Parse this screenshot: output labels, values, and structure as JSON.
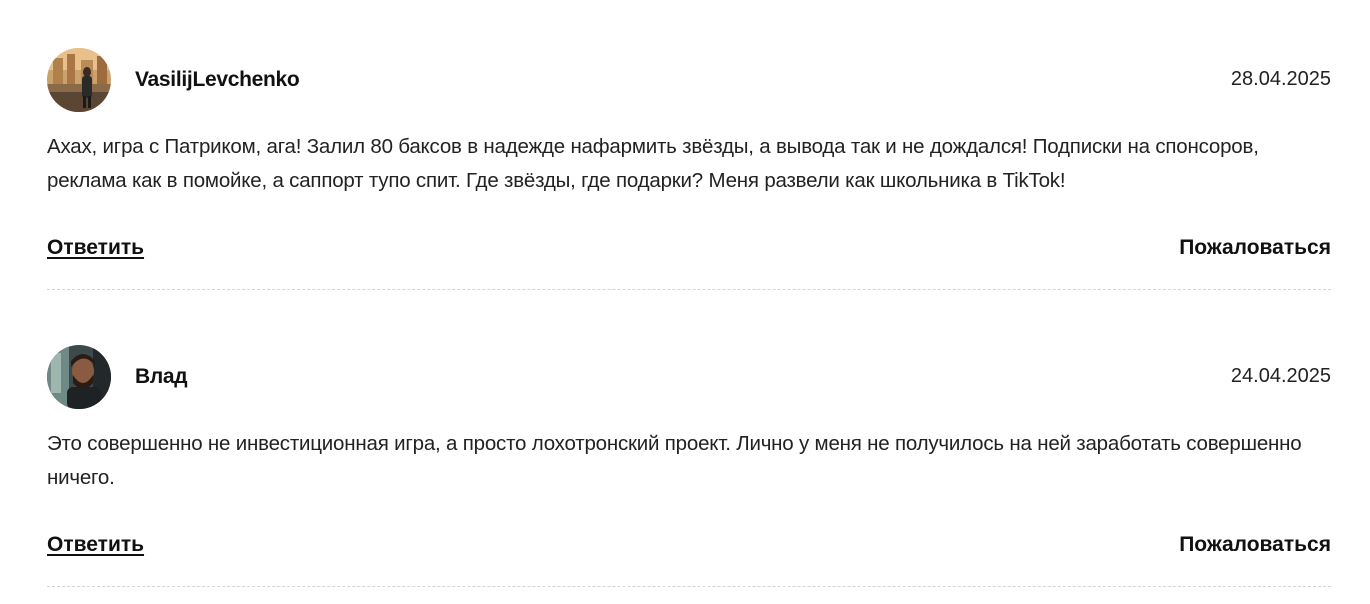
{
  "comments": [
    {
      "author": "VasilijLevchenko",
      "date": "28.04.2025",
      "text": "Ахах, игра с Патриком, ага! Залил 80 баксов в надежде нафармить звёзды, а вывода так и не дождался! Подписки на спонсоров, реклама как в помойке, а саппорт тупо спит. Где звёзды, где подарки? Меня развели как школьника в TikTok!",
      "reply_label": "Ответить",
      "report_label": "Пожаловаться"
    },
    {
      "author": "Влад",
      "date": "24.04.2025",
      "text": "Это совершенно не инвестиционная игра, а просто лохотронский проект. Лично у меня не получилось на ней заработать совершенно ничего.",
      "reply_label": "Ответить",
      "report_label": "Пожаловаться"
    }
  ]
}
